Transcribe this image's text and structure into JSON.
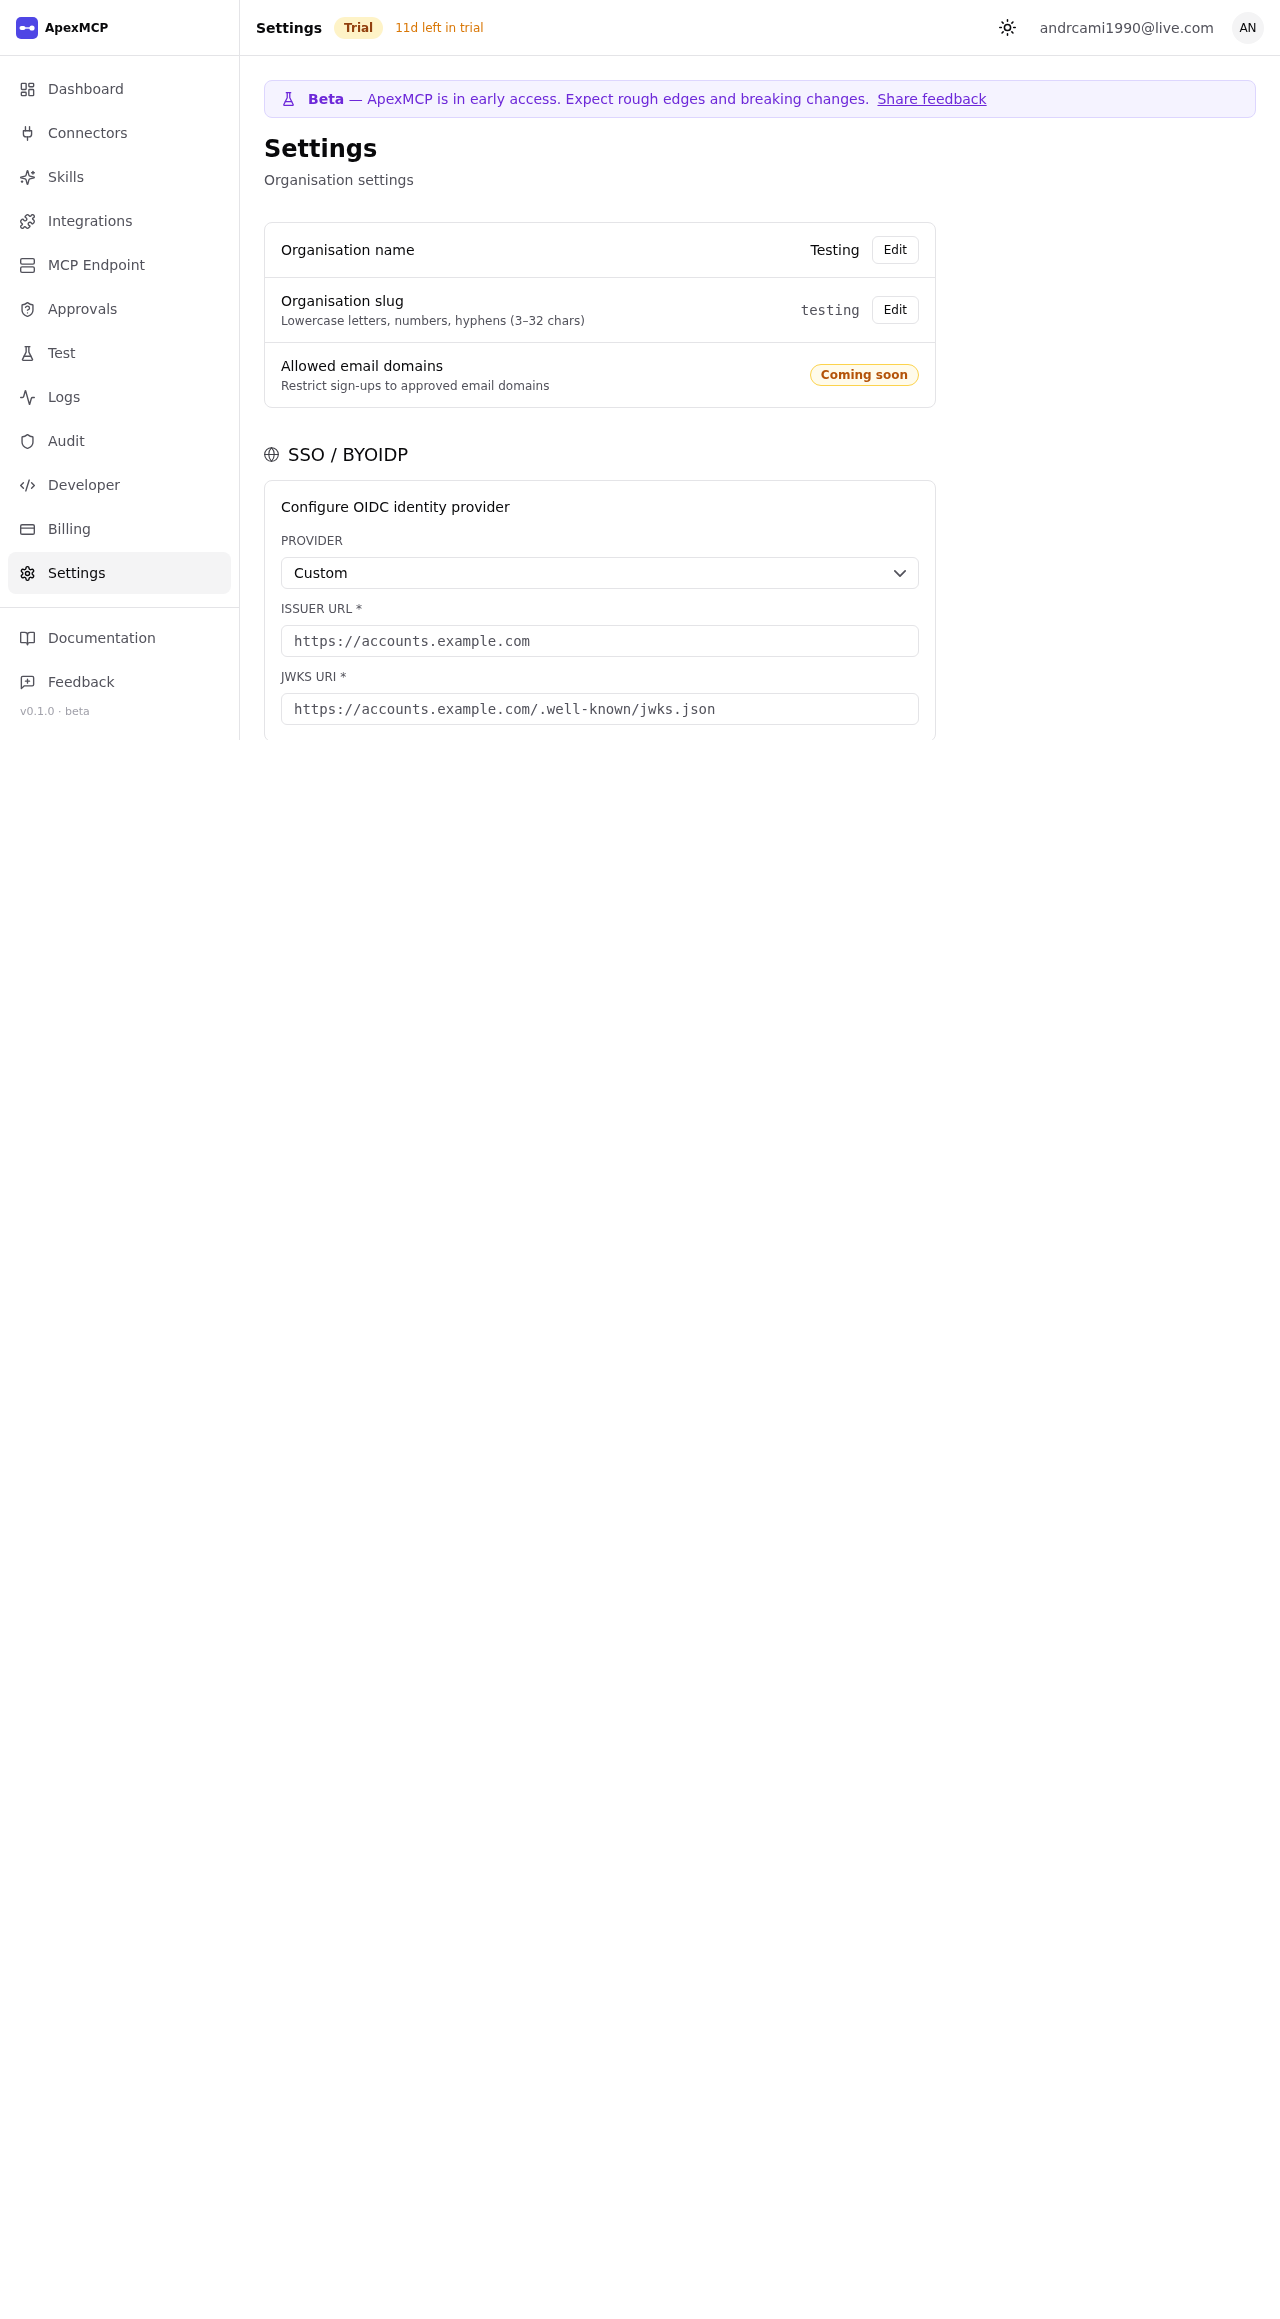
{
  "sidebar": {
    "brand": "ApexMCP",
    "nav_items": [
      {
        "label": "Dashboard",
        "selected": false
      },
      {
        "label": "Connectors",
        "selected": false
      },
      {
        "label": "Skills",
        "selected": false
      },
      {
        "label": "Integrations",
        "selected": false
      },
      {
        "label": "MCP Endpoint",
        "selected": false
      },
      {
        "label": "Approvals",
        "selected": false
      },
      {
        "label": "Test",
        "selected": false
      },
      {
        "label": "Logs",
        "selected": false
      },
      {
        "label": "Audit",
        "selected": false
      },
      {
        "label": "Developer",
        "selected": false
      },
      {
        "label": "Billing",
        "selected": false
      },
      {
        "label": "Settings",
        "selected": true
      }
    ],
    "footer_items": [
      {
        "label": "Documentation"
      },
      {
        "label": "Feedback"
      }
    ],
    "version": "v0.1.0 · beta"
  },
  "top_bar": {
    "title": "Settings",
    "plan_badge": "Trial",
    "trial_note": "11d left in trial",
    "user_email": "andrcami1990@live.com",
    "avatar_initials": "AN"
  },
  "banner": {
    "text": "**Beta** — ApexMCP is in early access. Expect rough edges and breaking changes.",
    "link": "Share feedback"
  },
  "page": {
    "title": "Settings",
    "subtitle": "Organisation settings"
  },
  "org_settings": {
    "rows": [
      {
        "kind": "text",
        "label": "Organisation name",
        "value": "Testing",
        "button": "Edit"
      },
      {
        "kind": "mono",
        "label": "Organisation slug",
        "hint": "Lowercase letters, numbers, hyphens (3–32 chars)",
        "value": "testing",
        "button": "Edit"
      },
      {
        "kind": "badge",
        "label": "Allowed email domains",
        "hint": "Restrict sign-ups to approved email domains",
        "badge": "Coming soon"
      }
    ]
  },
  "sso": {
    "title": "SSO / BYOIDP",
    "card_title": "Configure OIDC identity provider",
    "fields": [
      {
        "kind": "select",
        "label": "PROVIDER",
        "value": "Custom"
      },
      {
        "kind": "input",
        "label": "ISSUER URL *",
        "placeholder": "https://accounts.example.com"
      },
      {
        "kind": "input",
        "label": "JWKS URI *",
        "placeholder": "https://accounts.example.com/.well-known/jwks.json"
      }
    ]
  }
}
